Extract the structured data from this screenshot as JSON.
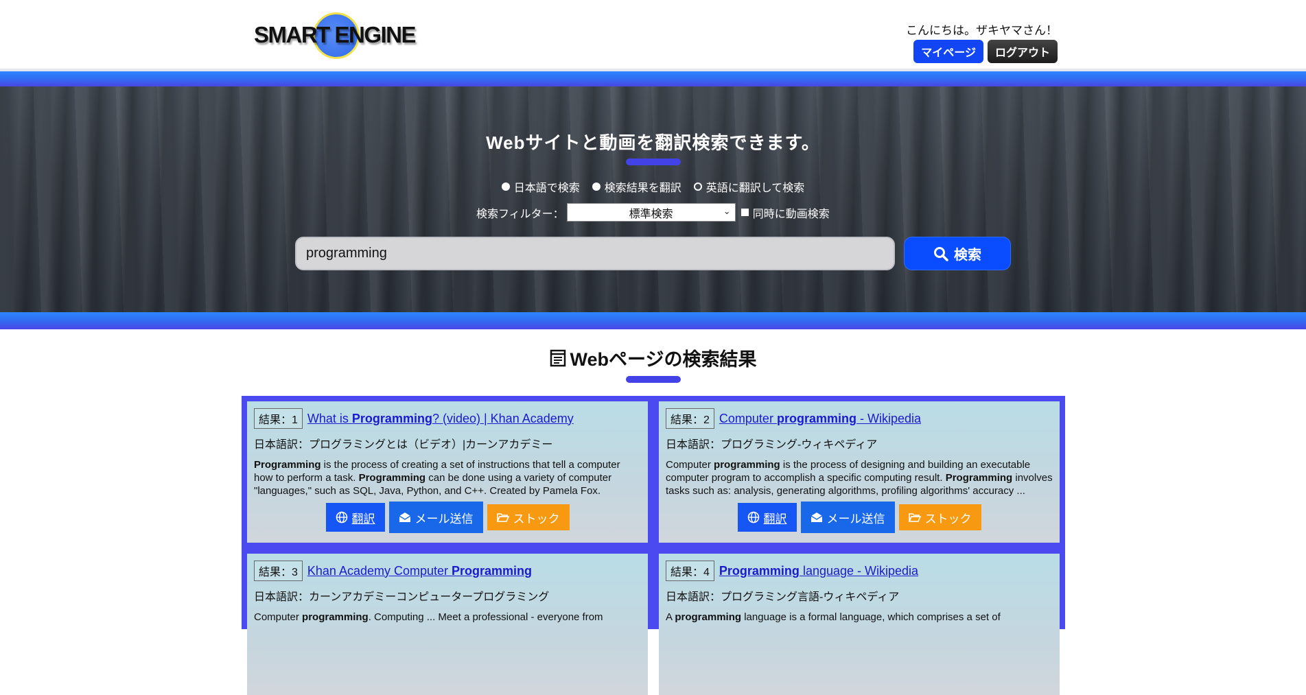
{
  "header": {
    "logo_text": "SMART ENGINE",
    "greeting": "こんにちは。ザキヤマさん！",
    "mypage_label": "マイページ",
    "logout_label": "ログアウト"
  },
  "hero": {
    "title": "Webサイトと動画を翻訳検索できます。",
    "radios": [
      {
        "label": "日本語で検索",
        "selected": true
      },
      {
        "label": "検索結果を翻訳",
        "selected": true
      },
      {
        "label": "英語に翻訳して検索",
        "selected": false
      }
    ],
    "filter_label": "検索フィルター：",
    "filter_value": "標準検索",
    "video_checkbox_label": "同時に動画検索",
    "search_value": "programming",
    "search_button_label": "検索"
  },
  "results": {
    "section_title": "Webページの検索結果",
    "items": [
      {
        "num": "結果：1",
        "title_pre": "What is ",
        "title_bold": "Programming",
        "title_post": "? (video) | Khan Academy",
        "jp": "日本語訳：プログラミングとは（ビデオ）|カーンアカデミー",
        "desc_html": "<b>Programming</b> is the process of creating a set of instructions that tell a computer how to perform a task. <b>Programming</b> can be done using a variety of computer \"languages,\" such as SQL, Java, Python, and C++. Created by Pamela Fox."
      },
      {
        "num": "結果：2",
        "title_pre": "Computer ",
        "title_bold": "programming",
        "title_post": " - Wikipedia",
        "jp": "日本語訳：プログラミング-ウィキペディア",
        "desc_html": "Computer <b>programming</b> is the process of designing and building an executable computer program to accomplish a specific computing result. <b>Programming</b> involves tasks such as: analysis, generating algorithms, profiling algorithms' accuracy ..."
      },
      {
        "num": "結果：3",
        "title_pre": "Khan Academy Computer ",
        "title_bold": "Programming",
        "title_post": "",
        "jp": "日本語訳：カーンアカデミーコンピュータープログラミング",
        "desc_html": "Computer <b>programming</b>. Computing ... Meet a professional - everyone from"
      },
      {
        "num": "結果：4",
        "title_pre": "",
        "title_bold": "Programming",
        "title_post": " language - Wikipedia",
        "jp": "日本語訳：プログラミング言語-ウィキペディア",
        "desc_html": "A <b>programming</b> language is a formal language, which comprises a set of"
      }
    ],
    "translate_label": "翻訳",
    "mail_label": "メール送信",
    "stock_label": "ストック"
  }
}
